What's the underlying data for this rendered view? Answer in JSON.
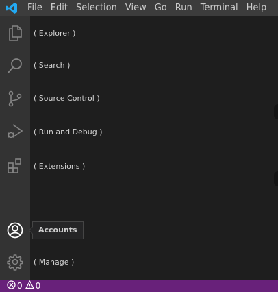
{
  "menu": {
    "items": [
      "File",
      "Edit",
      "Selection",
      "View",
      "Go",
      "Run",
      "Terminal",
      "Help"
    ]
  },
  "activity_bar": {
    "explorer_label": "( Explorer )",
    "search_label": "( Search )",
    "source_control_label": "( Source Control )",
    "run_debug_label": "( Run and Debug )",
    "extensions_label": "( Extensions )",
    "manage_label": "( Manage )"
  },
  "tooltip": {
    "accounts": "Accounts"
  },
  "status_bar": {
    "errors": "0",
    "warnings": "0",
    "background": "#68217a"
  },
  "icons": {
    "logo": "vscode-logo-icon",
    "explorer": "files-icon",
    "search": "search-icon",
    "source_control": "source-control-icon",
    "run_debug": "run-debug-icon",
    "extensions": "extensions-icon",
    "accounts": "account-icon",
    "manage": "gear-icon",
    "errors": "error-icon",
    "warnings": "warning-icon"
  },
  "colors": {
    "menubar": "#3c3c3c",
    "activity_bar": "#333333",
    "editor": "#1e1e1e",
    "logo": "#23a9f2"
  }
}
